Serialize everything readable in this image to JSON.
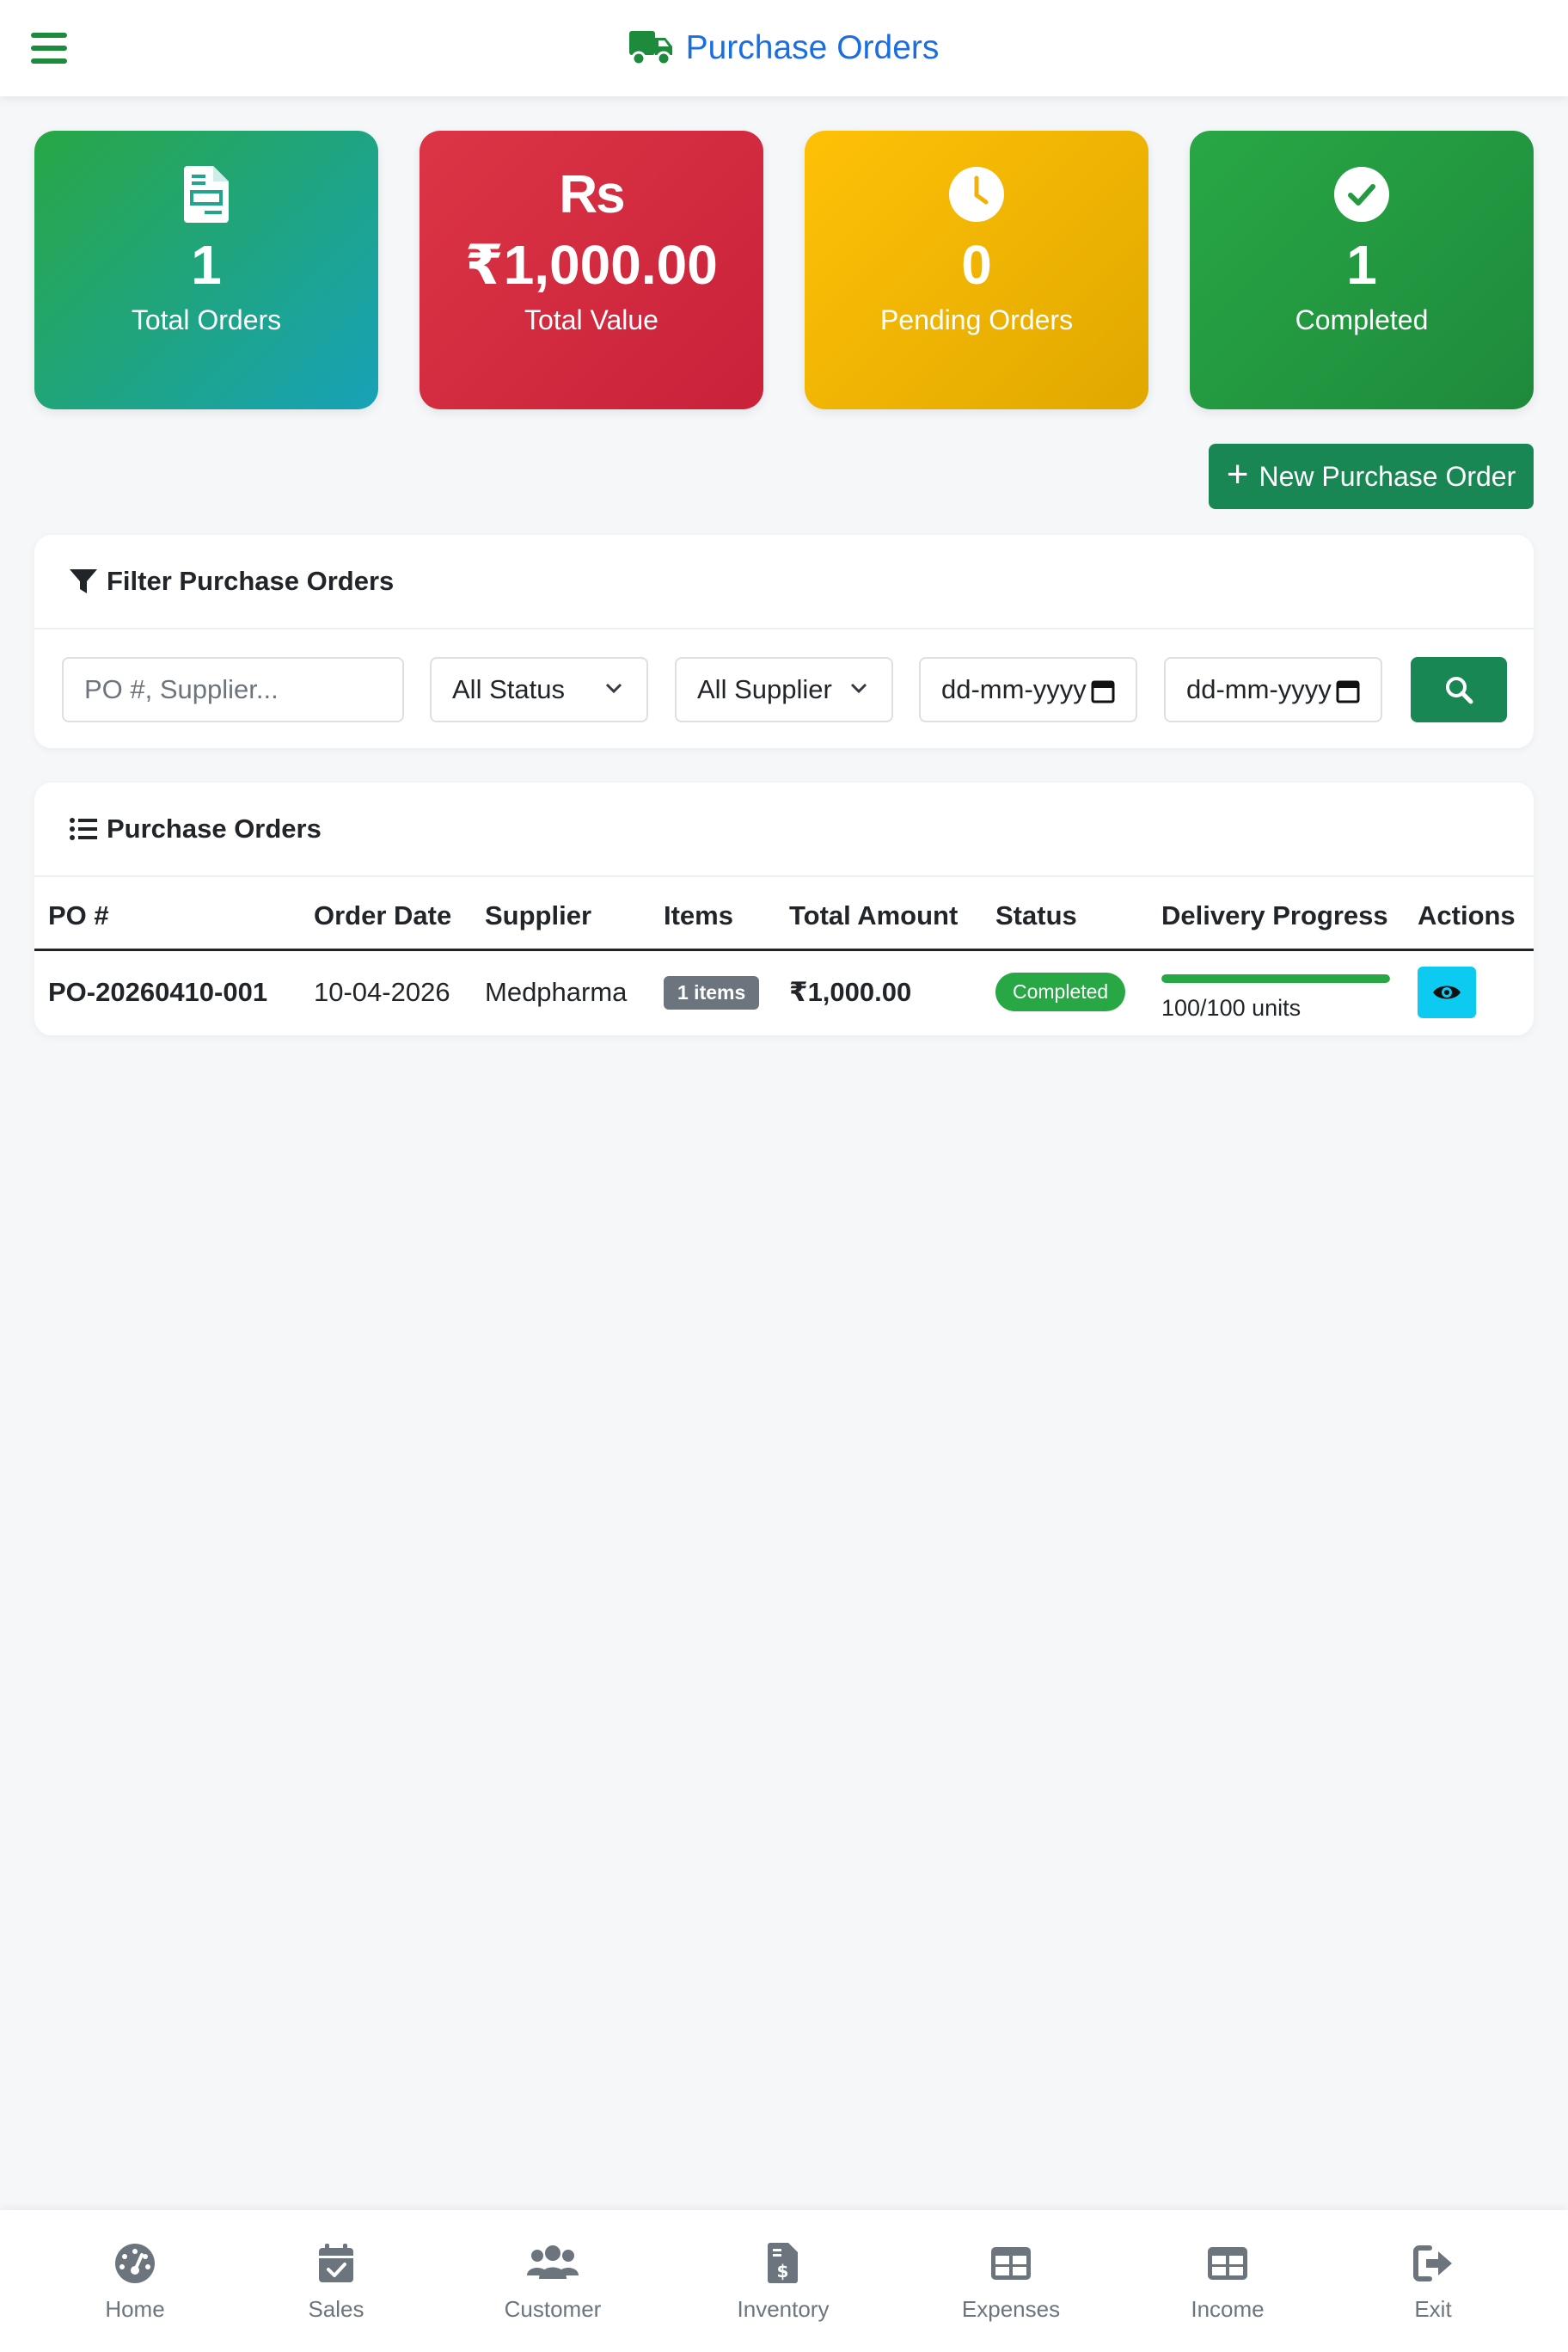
{
  "header": {
    "title": "Purchase Orders",
    "menu_icon": "hamburger-icon",
    "title_icon": "truck-icon"
  },
  "stats": [
    {
      "value": "1",
      "label": "Total Orders",
      "icon": "file-invoice-icon"
    },
    {
      "value": "₹1,000.00",
      "label": "Total Value",
      "icon_text": "Rs"
    },
    {
      "value": "0",
      "label": "Pending Orders",
      "icon": "clock-icon"
    },
    {
      "value": "1",
      "label": "Completed",
      "icon": "check-circle-icon"
    }
  ],
  "actions": {
    "new_po_label": "New Purchase Order"
  },
  "filter": {
    "title": "Filter Purchase Orders",
    "search_placeholder": "PO #, Supplier...",
    "status_selected": "All Status",
    "supplier_selected": "All Supplier",
    "date_from_placeholder": "dd-mm-yyyy",
    "date_to_placeholder": "dd-mm-yyyy"
  },
  "orders": {
    "title": "Purchase Orders",
    "columns": [
      "PO #",
      "Order Date",
      "Supplier",
      "Items",
      "Total Amount",
      "Status",
      "Delivery Progress",
      "Actions"
    ],
    "rows": [
      {
        "po": "PO-20260410-001",
        "date": "10-04-2026",
        "supplier": "Medpharma",
        "items": "1 items",
        "total": "₹1,000.00",
        "status": "Completed",
        "progress_fraction": 1.0,
        "progress_text": "100/100 units"
      }
    ]
  },
  "bottom_nav": [
    {
      "label": "Home",
      "icon": "dashboard-gauge-icon"
    },
    {
      "label": "Sales",
      "icon": "calendar-check-icon"
    },
    {
      "label": "Customer",
      "icon": "users-icon"
    },
    {
      "label": "Inventory",
      "icon": "invoice-dollar-icon"
    },
    {
      "label": "Expenses",
      "icon": "table-icon"
    },
    {
      "label": "Income",
      "icon": "table-icon"
    },
    {
      "label": "Exit",
      "icon": "sign-out-icon"
    }
  ],
  "colors": {
    "brand_green": "#198754",
    "title_blue": "#1a6fe0",
    "card_red": "#dc3545",
    "card_yellow": "#ffc107",
    "info_cyan": "#0dcaf0"
  }
}
